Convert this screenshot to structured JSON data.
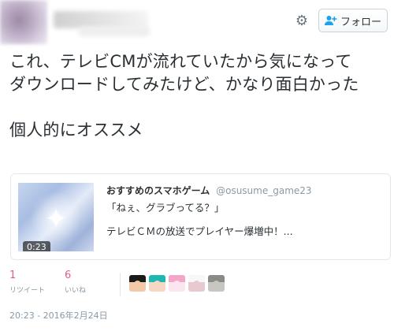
{
  "header": {
    "follow_label": "フォロー",
    "icons": [
      "gear-icon",
      "add-user-icon"
    ]
  },
  "tweet": {
    "lines": [
      "これ、テレビCMが流れていたから気になって",
      "ダウンロードしてみたけど、かなり面白かった",
      "個人的にオススメ"
    ]
  },
  "card": {
    "account_name": "おすすめのスマホゲーム",
    "account_handle": "@osusume_game23",
    "description_1": "「ねぇ、グラブってる？」",
    "description_2": "テレビＣＭの放送でプレイヤー爆増中！...",
    "video_duration": "0:23"
  },
  "stats": {
    "retweets_count": "1",
    "retweets_label": "リツイート",
    "likes_count": "6",
    "likes_label": "いいね"
  },
  "likers": [
    {
      "colors": [
        "#1a1a1a",
        "#f2c9a8"
      ]
    },
    {
      "colors": [
        "#1fb8b0",
        "#f6d7c3"
      ]
    },
    {
      "colors": [
        "#f3a6c8",
        "#fbe6ef"
      ]
    },
    {
      "colors": [
        "#f7f7f7",
        "#e8c9d0"
      ]
    },
    {
      "colors": [
        "#8a8a86",
        "#c7c6c0"
      ]
    }
  ],
  "timestamp": "20:23 - 2016年2月24日",
  "colors": {
    "text": "#292f33",
    "muted": "#8899a6",
    "stat_count": "#e0245e",
    "border": "#e1e8ed"
  }
}
